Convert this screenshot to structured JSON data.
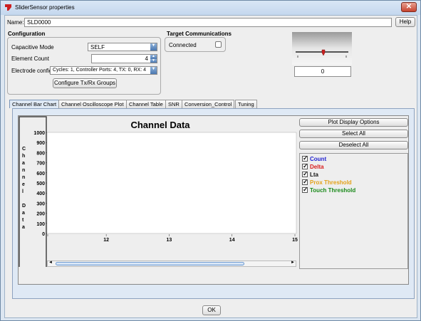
{
  "window": {
    "title": "SliderSensor properties",
    "close_glyph": "✕"
  },
  "name_row": {
    "label": "Name:",
    "value": "SLD0000",
    "help_label": "Help"
  },
  "configuration": {
    "heading": "Configuration",
    "capacitive_mode_label": "Capacitive Mode",
    "capacitive_mode_value": "SELF",
    "element_count_label": "Element Count",
    "element_count_value": "4",
    "electrode_config_label": "Electrode config",
    "electrode_config_value": "Cycles: 1, Controller Ports: 4, TX: 0, RX: 4",
    "configure_button": "Configure Tx/Rx Groups"
  },
  "target": {
    "heading": "Target Communications",
    "connected_label": "Connected",
    "connected": false
  },
  "slider_preview": {
    "readout": "0",
    "position": 0
  },
  "tabs": [
    {
      "label": "Channel Bar Chart",
      "active": true
    },
    {
      "label": "Channel Oscilloscope Plot",
      "active": false
    },
    {
      "label": "Channel Table",
      "active": false
    },
    {
      "label": "SNR",
      "active": false
    },
    {
      "label": "Conversion_Control",
      "active": false
    },
    {
      "label": "Tuning",
      "active": false
    }
  ],
  "side_buttons": {
    "plot_display_options": "Plot Display Options",
    "select_all": "Select All",
    "deselect_all": "Deselect All"
  },
  "legend": [
    {
      "label": "Count",
      "color": "#1f1fd0",
      "checked": true
    },
    {
      "label": "Delta",
      "color": "#d81b1b",
      "checked": true
    },
    {
      "label": "Lta",
      "color": "#111111",
      "checked": true
    },
    {
      "label": "Prox Threshold",
      "color": "#e3a21a",
      "checked": true
    },
    {
      "label": "Touch Threshold",
      "color": "#1a8a1a",
      "checked": true
    }
  ],
  "chart_data": {
    "type": "bar",
    "title": "Channel Data",
    "ylabel": "Channel Data",
    "ylim": [
      0,
      1000
    ],
    "yticks": [
      0,
      100,
      200,
      300,
      400,
      500,
      600,
      700,
      800,
      900,
      1000
    ],
    "xticks": [
      "12",
      "13",
      "14",
      "15"
    ],
    "series": []
  },
  "footer": {
    "ok_label": "OK"
  }
}
